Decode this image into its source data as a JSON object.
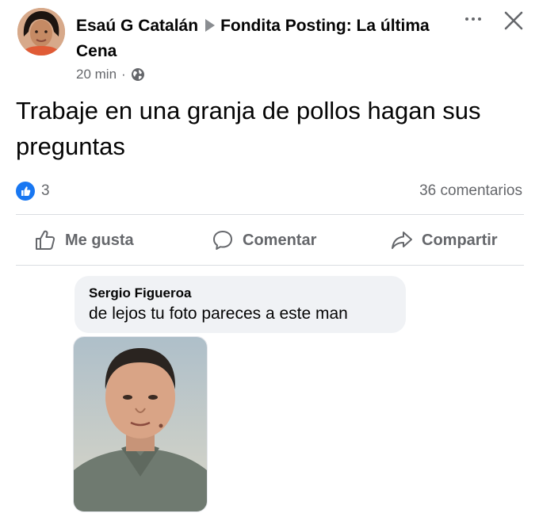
{
  "post": {
    "author": "Esaú G Catalán",
    "group": "Fondita Posting: La última Cena",
    "time": "20 min",
    "privacy_icon": "globe-icon",
    "text": "Trabaje en una granja de pollos hagan sus preguntas",
    "reactions_count": "3",
    "comments_count": "36 comentarios"
  },
  "actions": {
    "like": "Me gusta",
    "comment": "Comentar",
    "share": "Compartir"
  },
  "comment": {
    "author": "Sergio Figueroa",
    "text": "de lejos tu foto pareces a este man"
  },
  "colors": {
    "accent": "#1877f2",
    "secondary_text": "#65676b",
    "bubble": "#f0f2f5",
    "divider": "#dadde1"
  }
}
